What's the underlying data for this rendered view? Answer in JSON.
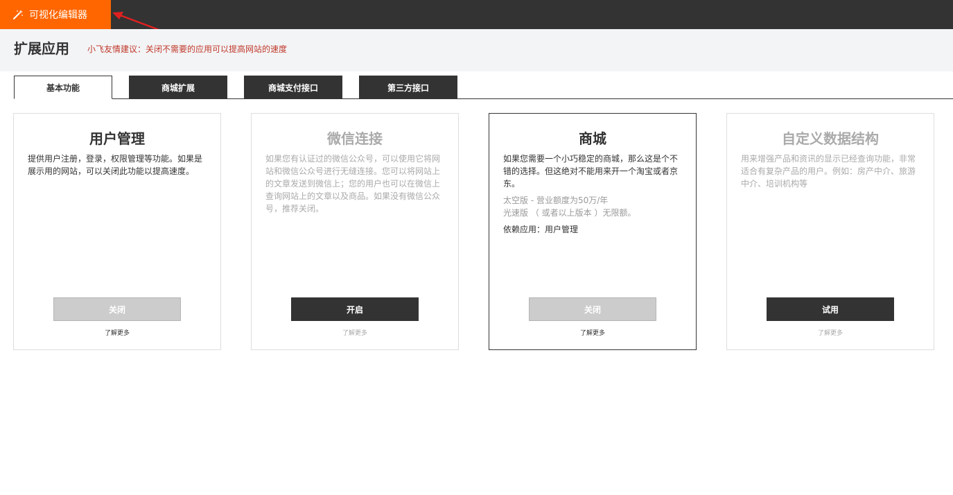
{
  "editor_button": {
    "label": "可视化编辑器",
    "icon": "magic-wand-icon"
  },
  "page": {
    "title": "扩展应用",
    "tip": "小飞友情建议：关闭不需要的应用可以提高网站的速度"
  },
  "tabs": [
    {
      "label": "基本功能",
      "active": true
    },
    {
      "label": "商城扩展",
      "active": false
    },
    {
      "label": "商城支付接口",
      "active": false
    },
    {
      "label": "第三方接口",
      "active": false
    }
  ],
  "cards": [
    {
      "title": "用户管理",
      "description": "提供用户注册，登录，权限管理等功能。如果是展示用的网站，可以关闭此功能以提高速度。",
      "button": "关闭",
      "more": "了解更多"
    },
    {
      "title": "微信连接",
      "description": "如果您有认证过的微信公众号，可以使用它将网站和微信公众号进行无缝连接。您可以将网站上的文章发送到微信上；您的用户也可以在微信上查询网站上的文章以及商品。如果没有微信公众号，推荐关闭。",
      "button": "开启",
      "more": "了解更多"
    },
    {
      "title": "商城",
      "description": "如果您需要一个小巧稳定的商城，那么这是个不错的选择。但这绝对不能用来开一个淘宝或者京东。",
      "extra_line1": "太空版 - 营业额度为50万/年",
      "extra_line2": "光速版 （ 或者以上版本 ）无限额。",
      "dependency": "依赖应用：用户管理",
      "button": "关闭",
      "more": "了解更多"
    },
    {
      "title": "自定义数据结构",
      "description": "用来增强产品和资讯的显示已经查询功能，非常适合有复杂产品的用户。例如：房产中介、旅游中介、培训机构等",
      "button": "试用",
      "more": "了解更多"
    }
  ],
  "colors": {
    "accent": "#ff6600",
    "dark": "#333333",
    "tip": "#c0392b",
    "disabled": "#cccccc"
  }
}
